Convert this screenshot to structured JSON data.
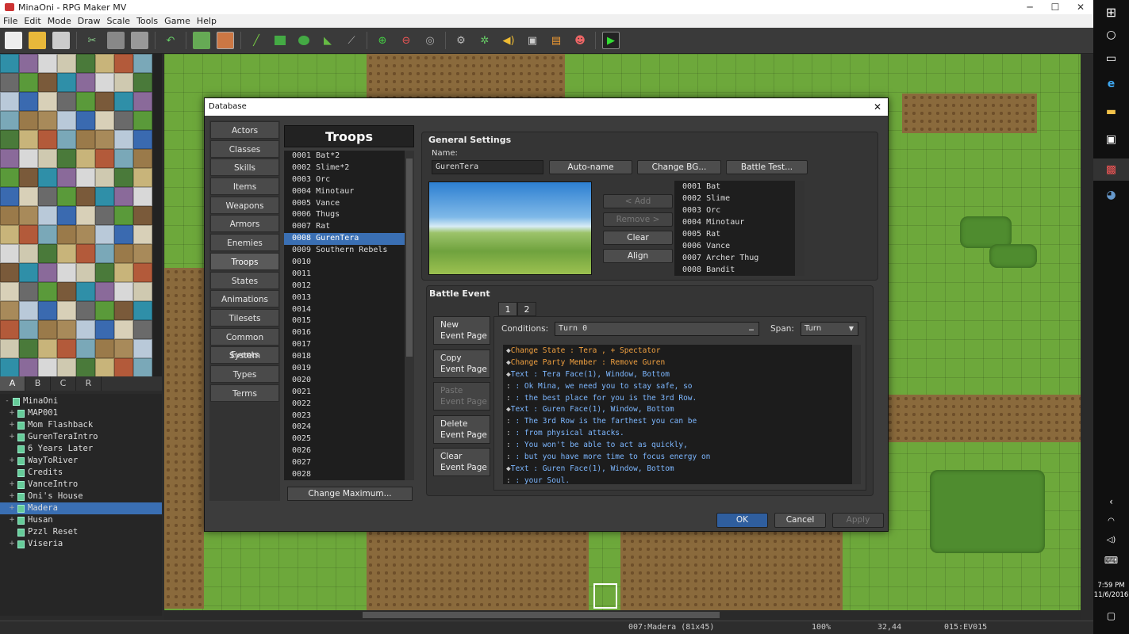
{
  "window": {
    "title": "MinaOni - RPG Maker MV"
  },
  "menu": [
    "File",
    "Edit",
    "Mode",
    "Draw",
    "Scale",
    "Tools",
    "Game",
    "Help"
  ],
  "tileset_tabs": [
    "A",
    "B",
    "C",
    "R"
  ],
  "tileset_active_tab": "A",
  "map_tree": [
    {
      "label": "MinaOni",
      "expand": "-",
      "indent": 0
    },
    {
      "label": "MAP001",
      "expand": "+",
      "indent": 1
    },
    {
      "label": "Mom Flashback",
      "expand": "+",
      "indent": 1
    },
    {
      "label": "GurenTeraIntro",
      "expand": "+",
      "indent": 1
    },
    {
      "label": "6 Years Later",
      "expand": "",
      "indent": 1
    },
    {
      "label": "WayToRiver",
      "expand": "+",
      "indent": 1
    },
    {
      "label": "Credits",
      "expand": "",
      "indent": 1
    },
    {
      "label": "VanceIntro",
      "expand": "+",
      "indent": 1
    },
    {
      "label": "Oni's House",
      "expand": "+",
      "indent": 1
    },
    {
      "label": "Madera",
      "expand": "+",
      "indent": 1,
      "selected": true
    },
    {
      "label": "Husan",
      "expand": "+",
      "indent": 1
    },
    {
      "label": "Pzzl Reset",
      "expand": "",
      "indent": 1
    },
    {
      "label": "Viseria",
      "expand": "+",
      "indent": 1
    }
  ],
  "status": {
    "map": "007:Madera (81x45)",
    "zoom": "100%",
    "coords": "32,44",
    "event": "015:EV015"
  },
  "clock": {
    "time": "7:59 PM",
    "date": "11/6/2016"
  },
  "dialog": {
    "title": "Database",
    "close": "✕",
    "nav": [
      "Actors",
      "Classes",
      "Skills",
      "Items",
      "Weapons",
      "Armors",
      "Enemies",
      "Troops",
      "States",
      "Animations",
      "Tilesets",
      "Common Events",
      "System",
      "Types",
      "Terms"
    ],
    "nav_selected": "Troops",
    "troops_header": "Troops",
    "troops": [
      "0001 Bat*2",
      "0002 Slime*2",
      "0003 Orc",
      "0004 Minotaur",
      "0005 Vance",
      "0006 Thugs",
      "0007 Rat",
      "0008 GurenTera",
      "0009 Southern Rebels",
      "0010",
      "0011",
      "0012",
      "0013",
      "0014",
      "0015",
      "0016",
      "0017",
      "0018",
      "0019",
      "0020",
      "0021",
      "0022",
      "0023",
      "0024",
      "0025",
      "0026",
      "0027",
      "0028"
    ],
    "troops_selected_index": 7,
    "change_max": "Change Maximum...",
    "general": {
      "label": "General Settings",
      "name_label": "Name:",
      "name_value": "GurenTera",
      "auto_name": "Auto-name",
      "change_bg": "Change BG...",
      "battle_test": "Battle Test...",
      "add": "< Add",
      "remove": "Remove >",
      "clear": "Clear",
      "align": "Align",
      "enemies": [
        "0001 Bat",
        "0002 Slime",
        "0003 Orc",
        "0004 Minotaur",
        "0005 Rat",
        "0006 Vance",
        "0007 Archer Thug",
        "0008 Bandit"
      ]
    },
    "battle_event": {
      "label": "Battle Event",
      "pages": [
        "1",
        "2"
      ],
      "active_page": "1",
      "new_page": [
        "New",
        "Event Page"
      ],
      "copy_page": [
        "Copy",
        "Event Page"
      ],
      "paste_page": [
        "Paste",
        "Event Page"
      ],
      "delete_page": [
        "Delete",
        "Event Page"
      ],
      "clear_page": [
        "Clear",
        "Event Page"
      ],
      "conditions_label": "Conditions:",
      "conditions_value": "Turn 0",
      "conditions_more": "…",
      "span_label": "Span:",
      "span_value": "Turn",
      "commands": [
        {
          "prefix": "◆",
          "kind": "o",
          "text": "Change State : Tera , + Spectator"
        },
        {
          "prefix": "◆",
          "kind": "o",
          "text": "Change Party Member : Remove Guren"
        },
        {
          "prefix": "◆",
          "kind": "b",
          "text": "Text : Tera Face(1), Window, Bottom"
        },
        {
          "prefix": " :",
          "kind": "b",
          "text": "     : Ok Mina, we need you to stay safe, so"
        },
        {
          "prefix": " :",
          "kind": "b",
          "text": "     : the best place for you is the 3rd Row."
        },
        {
          "prefix": "◆",
          "kind": "b",
          "text": "Text : Guren Face(1), Window, Bottom"
        },
        {
          "prefix": " :",
          "kind": "b",
          "text": "     : The 3rd Row is the farthest you can be"
        },
        {
          "prefix": " :",
          "kind": "b",
          "text": "     : from physical attacks."
        },
        {
          "prefix": " :",
          "kind": "b",
          "text": "     : You won't be able to act as quickly,"
        },
        {
          "prefix": " :",
          "kind": "b",
          "text": "     : but you have more time to focus energy on"
        },
        {
          "prefix": "◆",
          "kind": "b",
          "text": "Text : Guren Face(1), Window, Bottom"
        },
        {
          "prefix": " :",
          "kind": "b",
          "text": "     : your Soul."
        }
      ]
    },
    "ok": "OK",
    "cancel": "Cancel",
    "apply": "Apply"
  }
}
